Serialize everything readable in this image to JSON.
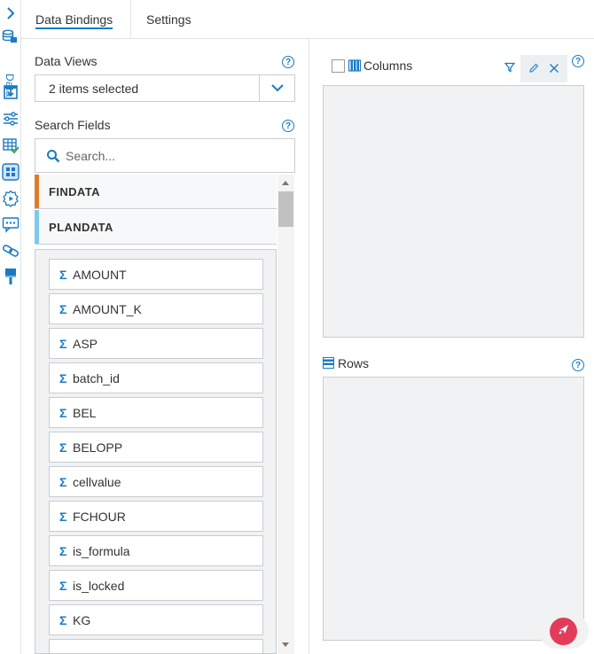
{
  "rail": {
    "vertical_label": "Data",
    "icons": [
      "chevron-right-icon",
      "database-icon",
      "import-icon",
      "sliders-icon",
      "table-check-icon",
      "grid-icon",
      "gear-play-icon",
      "comment-icon",
      "link-icon",
      "brush-icon"
    ]
  },
  "tabs": [
    {
      "label": "Data Bindings",
      "active": true
    },
    {
      "label": "Settings",
      "active": false
    }
  ],
  "left_panel": {
    "data_views_label": "Data Views",
    "data_views_value": "2 items selected",
    "search_fields_label": "Search Fields",
    "search_placeholder": "Search...",
    "datasets": [
      {
        "name": "FINDATA",
        "color": "#e07b2c"
      },
      {
        "name": "PLANDATA",
        "color": "#7dc9ee"
      }
    ],
    "fields": [
      "AMOUNT",
      "AMOUNT_K",
      "ASP",
      "batch_id",
      "BEL",
      "BELOPP",
      "cellvalue",
      "FCHOUR",
      "is_formula",
      "is_locked",
      "KG"
    ],
    "field_icon": "Σ"
  },
  "right_panel": {
    "columns_label": "Columns",
    "rows_label": "Rows"
  },
  "colors": {
    "accent": "#1a7bc4",
    "fab": "#e23c5a"
  }
}
